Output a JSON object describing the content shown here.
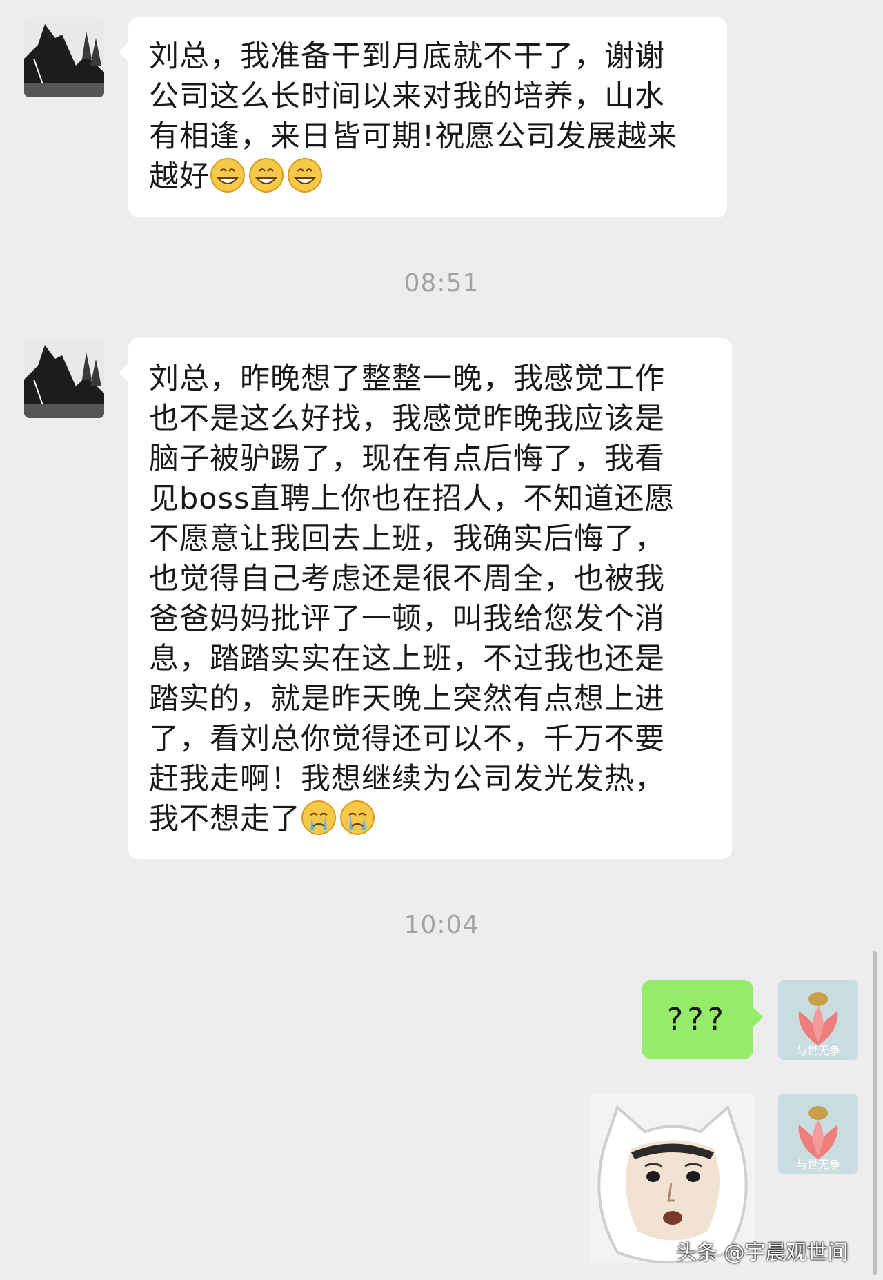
{
  "messages": {
    "msg1": {
      "lines": [
        "刘总，我准备干到月底就不干了，谢谢",
        "公司这么长时间以来对我的培养，山水",
        "有相逢，来日皆可期!祝愿公司发展越来"
      ],
      "last_line": "越好",
      "emoji": "grinning-face-icon"
    },
    "time1": "08:51",
    "msg2": {
      "lines": [
        "刘总，昨晚想了整整一晚，我感觉工作",
        "也不是这么好找，我感觉昨晚我应该是",
        "脑子被驴踢了，现在有点后悔了，我看",
        "见boss直聘上你也在招人，不知道还愿",
        "不愿意让我回去上班，我确实后悔了，",
        "也觉得自己考虑还是很不周全，也被我",
        "爸爸妈妈批评了一顿，叫我给您发个消",
        "息，踏踏实实在这上班，不过我也还是",
        "踏实的，就是昨天晚上突然有点想上进",
        "了，看刘总你觉得还可以不，千万不要",
        "赶我走啊！我想继续为公司发光发热，"
      ],
      "last_line": "我不想走了",
      "emoji": "crying-face-icon"
    },
    "time2": "10:04",
    "msg3": {
      "text": "???"
    },
    "sticker": {
      "name": "shocked-face-sticker"
    }
  },
  "avatars": {
    "self_caption": "与世无争"
  },
  "watermark": "头条 @宇晨观世间",
  "colors": {
    "background": "#ededed",
    "incoming_bubble": "#ffffff",
    "outgoing_bubble": "#95ec69",
    "timestamp": "#a3a3a3"
  }
}
